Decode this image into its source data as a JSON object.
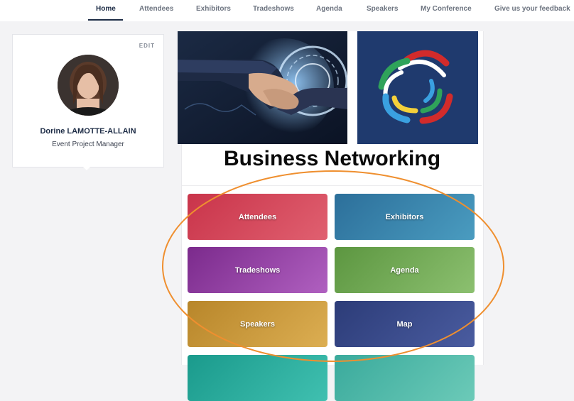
{
  "nav": {
    "items": [
      "Home",
      "Attendees",
      "Exhibitors",
      "Tradeshows",
      "Agenda",
      "Speakers",
      "My Conference",
      "Give us your feedback"
    ],
    "active": "Home"
  },
  "profile": {
    "edit_label": "EDIT",
    "name": "Dorine LAMOTTE-ALLAIN",
    "role": "Event Project Manager"
  },
  "section": {
    "title": "Business Networking"
  },
  "tiles": [
    {
      "label": "Attendees",
      "color_from": "#c9344a",
      "color_to": "#e06070"
    },
    {
      "label": "Exhibitors",
      "color_from": "#2c6f9a",
      "color_to": "#4a9cc0"
    },
    {
      "label": "Tradeshows",
      "color_from": "#7b2a8c",
      "color_to": "#b060c0"
    },
    {
      "label": "Agenda",
      "color_from": "#5c9640",
      "color_to": "#8cc070"
    },
    {
      "label": "Speakers",
      "color_from": "#b8862a",
      "color_to": "#dcae52"
    },
    {
      "label": "Map",
      "color_from": "#2c3c78",
      "color_to": "#4a5ca0"
    },
    {
      "label": "",
      "color_from": "#1a9a8c",
      "color_to": "#40c0b0"
    },
    {
      "label": "",
      "color_from": "#3aaa9c",
      "color_to": "#6ccab8"
    }
  ],
  "colors": {
    "nav_active": "#1c2b45",
    "nav_inactive": "#6d7480",
    "annotation_outline": "#ef8f2f",
    "logo_background": "#1f3a6e"
  },
  "icons": {
    "banner_left": "handshake-image",
    "banner_right": "spiral-logo"
  }
}
